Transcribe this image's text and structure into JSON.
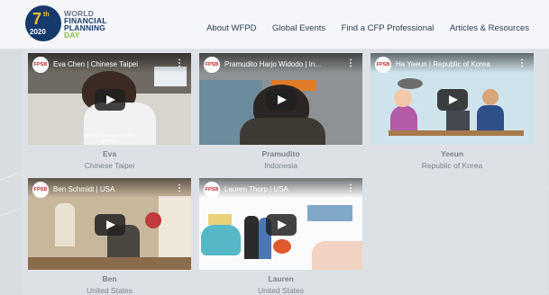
{
  "header": {
    "logo": {
      "number": "7",
      "suffix": "th",
      "year": "2020",
      "line1": "WORLD",
      "line2": "FINANCIAL",
      "line3": "PLANNING",
      "line4": "DAY"
    },
    "nav": [
      "About WFPD",
      "Global Events",
      "Find a CFP Professional",
      "Articles & Resources"
    ]
  },
  "videos": [
    {
      "title": "Eva Chen | Chinese Taipei",
      "name": "Eva",
      "country": "Chinese Taipei",
      "caption": "and the investment policy guide..."
    },
    {
      "title": "Pramudito Harjo Widodo | In...",
      "name": "Pramudito",
      "country": "Indonesia"
    },
    {
      "title": "Ha Yeeun | Republic of Korea",
      "name": "Yeeun",
      "country": "Republic of Korea"
    },
    {
      "title": "Ben Schmidt | USA",
      "name": "Ben",
      "country": "United States"
    },
    {
      "title": "Lauren Thorp | USA",
      "name": "Lauren",
      "country": "United States"
    }
  ],
  "icons": {
    "channel": "fpsb-logo-icon",
    "menu": "kebab-menu-icon",
    "play": "play-icon"
  },
  "colors": {
    "navy": "#163a6b",
    "gold": "#f2c23a",
    "green": "#8bbd45",
    "youtube_red": "#c0282d"
  }
}
